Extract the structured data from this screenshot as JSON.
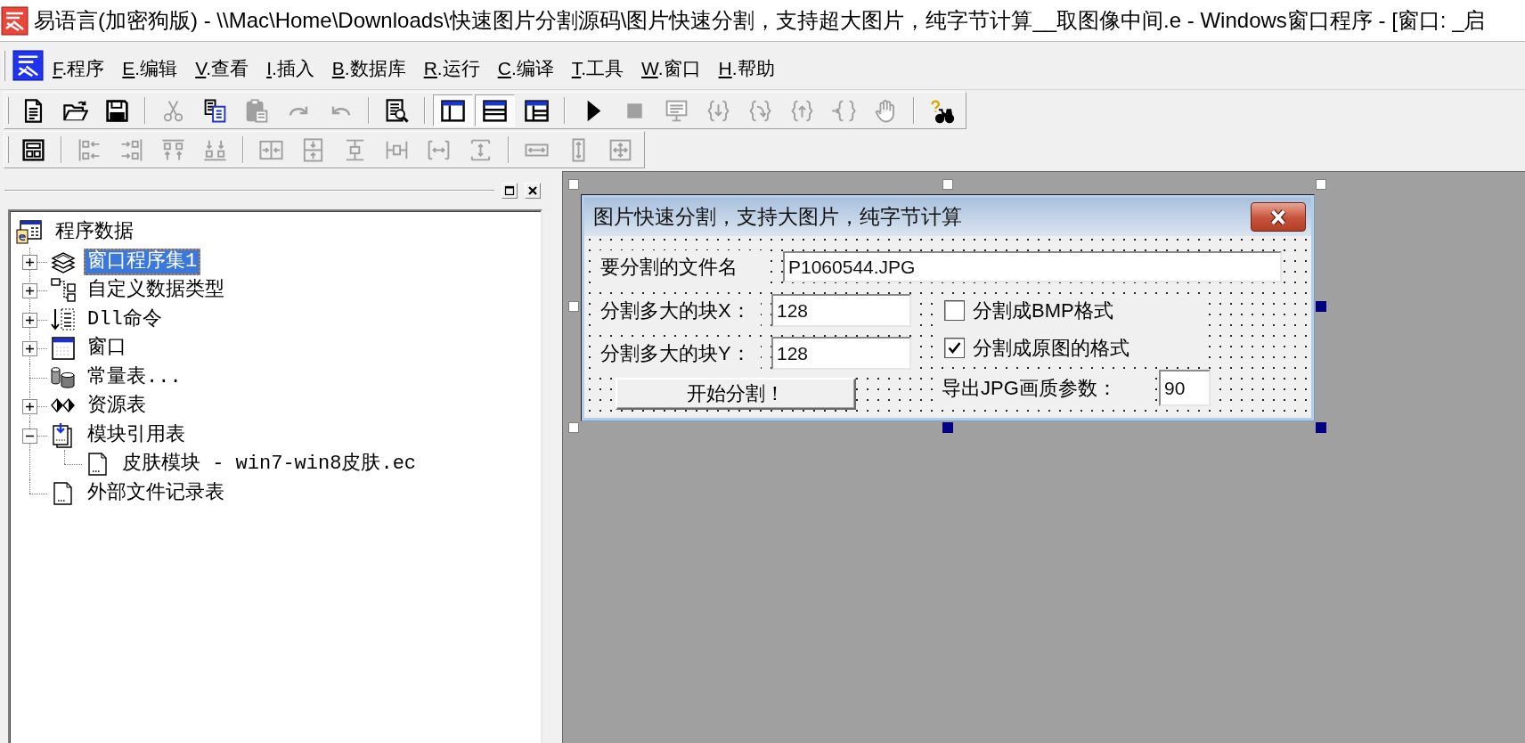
{
  "title_bar": {
    "title": "易语言(加密狗版) - \\\\Mac\\Home\\Downloads\\快速图片分割源码\\图片快速分割，支持超大图片，纯字节计算__取图像中间.e - Windows窗口程序 - [窗口: _启"
  },
  "menu": [
    "F.程序",
    "E.编辑",
    "V.查看",
    "I.插入",
    "B.数据库",
    "R.运行",
    "C.编译",
    "T.工具",
    "W.窗口",
    "H.帮助"
  ],
  "toolbars": [
    {
      "groups": [
        [
          {
            "kind": "document",
            "disabled": false,
            "pressed": false
          },
          {
            "kind": "folder",
            "disabled": false,
            "pressed": false
          },
          {
            "kind": "floppy",
            "disabled": false,
            "pressed": false
          }
        ],
        [
          {
            "kind": "scissors",
            "disabled": true,
            "pressed": false
          },
          {
            "kind": "copy",
            "disabled": false,
            "pressed": false
          },
          {
            "kind": "clipboard",
            "disabled": true,
            "pressed": false
          },
          {
            "kind": "redo",
            "disabled": true,
            "pressed": false
          },
          {
            "kind": "undo",
            "disabled": true,
            "pressed": false
          }
        ],
        [
          {
            "kind": "preview",
            "disabled": false,
            "pressed": false
          }
        ],
        [
          {
            "kind": "panesleft",
            "disabled": false,
            "pressed": true
          },
          {
            "kind": "panesbottom",
            "disabled": false,
            "pressed": true
          },
          {
            "kind": "panesboth",
            "disabled": false,
            "pressed": false
          }
        ],
        [
          {
            "kind": "play",
            "disabled": false,
            "pressed": false
          },
          {
            "kind": "stop",
            "disabled": true,
            "pressed": false
          },
          {
            "kind": "monitor",
            "disabled": true,
            "pressed": false
          },
          {
            "kind": "bracesin",
            "disabled": true,
            "pressed": false
          },
          {
            "kind": "bracesover",
            "disabled": true,
            "pressed": false
          },
          {
            "kind": "bracesout",
            "disabled": true,
            "pressed": false
          },
          {
            "kind": "bracescursor",
            "disabled": true,
            "pressed": false
          },
          {
            "kind": "hand",
            "disabled": true,
            "pressed": false
          }
        ],
        [
          {
            "kind": "binoculars",
            "disabled": false,
            "pressed": false
          }
        ]
      ]
    },
    {
      "groups": [
        [
          {
            "kind": "form",
            "disabled": false
          }
        ],
        [
          {
            "kind": "alignleft",
            "disabled": true
          },
          {
            "kind": "alignright",
            "disabled": true
          },
          {
            "kind": "aligntop",
            "disabled": true
          },
          {
            "kind": "alignbottom",
            "disabled": true
          }
        ],
        [
          {
            "kind": "centerh",
            "disabled": true
          },
          {
            "kind": "centerv",
            "disabled": true
          },
          {
            "kind": "spacev",
            "disabled": true
          },
          {
            "kind": "spaceh",
            "disabled": true
          },
          {
            "kind": "spreadh",
            "disabled": true
          },
          {
            "kind": "spreadv",
            "disabled": true
          }
        ],
        [
          {
            "kind": "samewidth",
            "disabled": true
          },
          {
            "kind": "sameheight",
            "disabled": true
          },
          {
            "kind": "samesize",
            "disabled": true
          }
        ]
      ]
    }
  ],
  "project_panel": {
    "tree": {
      "label": "程序数据",
      "kind": "project",
      "selected": false,
      "children": [
        {
          "label": "窗口程序集1",
          "kind": "stack",
          "expanded": false,
          "selected": true
        },
        {
          "label": "自定义数据类型",
          "kind": "boxes",
          "expanded": false,
          "selected": false
        },
        {
          "label": "Dll命令",
          "kind": "arrowlist",
          "expanded": false,
          "selected": false
        },
        {
          "label": "窗口",
          "kind": "window",
          "expanded": false,
          "selected": false
        },
        {
          "label": "常量表...",
          "kind": "cylinders",
          "selected": false
        },
        {
          "label": "资源表",
          "kind": "diamonds",
          "expanded": false,
          "selected": false
        },
        {
          "label": "模块引用表",
          "kind": "import",
          "expanded": true,
          "selected": false,
          "children": [
            {
              "label": "皮肤模块 - win7-win8皮肤.ec",
              "kind": "page",
              "selected": false
            }
          ]
        },
        {
          "label": "外部文件记录表",
          "kind": "page",
          "selected": false
        }
      ]
    }
  },
  "designer": {
    "selection_handles": {
      "top_left": {
        "filled": false
      },
      "top_center": {
        "filled": false
      },
      "top_right": {
        "filled": false
      },
      "middle_left": {
        "filled": false
      },
      "middle_right": {
        "filled": true
      },
      "bottom_left": {
        "filled": false
      },
      "bottom_center": {
        "filled": true
      },
      "bottom_right": {
        "filled": true
      }
    },
    "form": {
      "title": "图片快速分割，支持大图片，纯字节计算",
      "file_field": {
        "label": "要分割的文件名",
        "value": "P1060544.JPG"
      },
      "left": [
        {
          "kind": "field",
          "label": "分割多大的块X：",
          "value": "128"
        },
        {
          "kind": "field",
          "label": "分割多大的块Y：",
          "value": "128"
        },
        {
          "kind": "button",
          "label": "开始分割！"
        }
      ],
      "right": [
        {
          "kind": "checkbox",
          "label": "分割成BMP格式",
          "checked": false
        },
        {
          "kind": "checkbox",
          "label": "分割成原图的格式",
          "checked": true
        },
        {
          "kind": "field",
          "label": "导出JPG画质参数：",
          "value": "90"
        }
      ]
    }
  }
}
